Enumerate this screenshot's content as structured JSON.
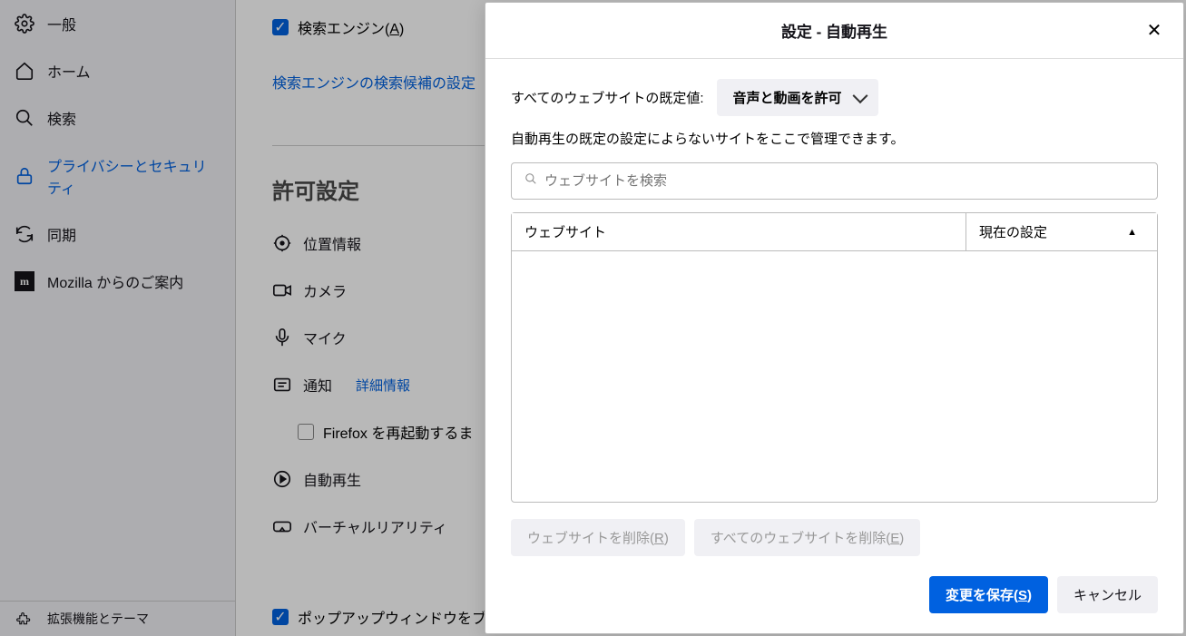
{
  "sidebar": {
    "items": [
      {
        "label": "一般"
      },
      {
        "label": "ホーム"
      },
      {
        "label": "検索"
      },
      {
        "label": "プライバシーとセキュリティ"
      },
      {
        "label": "同期"
      },
      {
        "label": "Mozilla からのご案内"
      }
    ],
    "bottom": {
      "label": "拡張機能とテーマ"
    }
  },
  "main": {
    "search_engines_label_pre": "検索エンジン(",
    "search_engines_label_u": "A",
    "search_engines_label_post": ")",
    "search_suggestions_link": "検索エンジンの検索候補の設定",
    "permissions_title": "許可設定",
    "location": "位置情報",
    "camera": "カメラ",
    "microphone": "マイク",
    "notifications": "通知",
    "notifications_link": "詳細情報",
    "firefox_restart": "Firefox を再起動するま",
    "autoplay": "自動再生",
    "vr": "バーチャルリアリティ",
    "popup": "ポップアップウィンドウをブロッ"
  },
  "dialog": {
    "title": "設定 - 自動再生",
    "default_label": "すべてのウェブサイトの既定値:",
    "default_value": "音声と動画を許可",
    "description": "自動再生の既定の設定によらないサイトをここで管理できます。",
    "search_placeholder": "ウェブサイトを検索",
    "col_website": "ウェブサイト",
    "col_status": "現在の設定",
    "remove_site_pre": "ウェブサイトを削除(",
    "remove_site_u": "R",
    "remove_site_post": ")",
    "remove_all_pre": "すべてのウェブサイトを削除(",
    "remove_all_u": "E",
    "remove_all_post": ")",
    "save_pre": "変更を保存(",
    "save_u": "S",
    "save_post": ")",
    "cancel": "キャンセル"
  }
}
